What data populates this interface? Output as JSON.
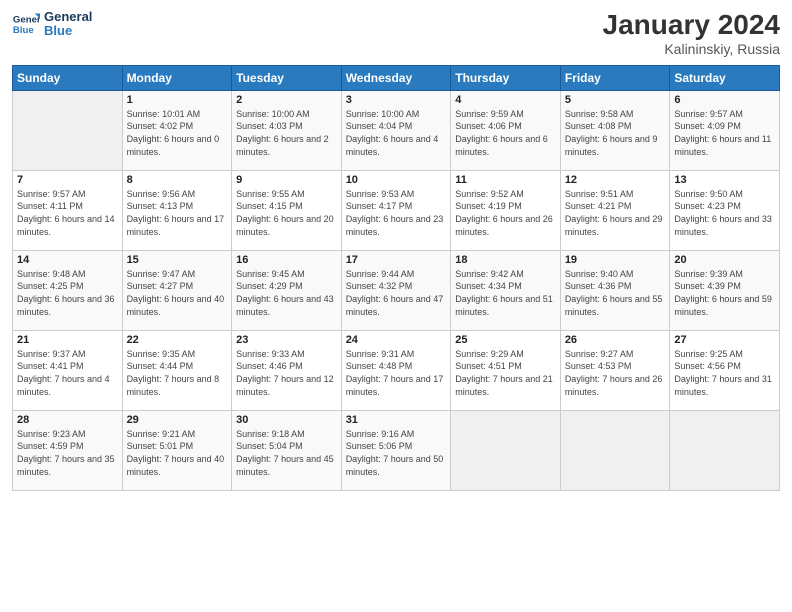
{
  "header": {
    "logo_line1": "General",
    "logo_line2": "Blue",
    "month": "January 2024",
    "location": "Kalininskiy, Russia"
  },
  "weekdays": [
    "Sunday",
    "Monday",
    "Tuesday",
    "Wednesday",
    "Thursday",
    "Friday",
    "Saturday"
  ],
  "weeks": [
    [
      {
        "day": "",
        "sunrise": "",
        "sunset": "",
        "daylight": ""
      },
      {
        "day": "1",
        "sunrise": "Sunrise: 10:01 AM",
        "sunset": "Sunset: 4:02 PM",
        "daylight": "Daylight: 6 hours and 0 minutes."
      },
      {
        "day": "2",
        "sunrise": "Sunrise: 10:00 AM",
        "sunset": "Sunset: 4:03 PM",
        "daylight": "Daylight: 6 hours and 2 minutes."
      },
      {
        "day": "3",
        "sunrise": "Sunrise: 10:00 AM",
        "sunset": "Sunset: 4:04 PM",
        "daylight": "Daylight: 6 hours and 4 minutes."
      },
      {
        "day": "4",
        "sunrise": "Sunrise: 9:59 AM",
        "sunset": "Sunset: 4:06 PM",
        "daylight": "Daylight: 6 hours and 6 minutes."
      },
      {
        "day": "5",
        "sunrise": "Sunrise: 9:58 AM",
        "sunset": "Sunset: 4:08 PM",
        "daylight": "Daylight: 6 hours and 9 minutes."
      },
      {
        "day": "6",
        "sunrise": "Sunrise: 9:57 AM",
        "sunset": "Sunset: 4:09 PM",
        "daylight": "Daylight: 6 hours and 11 minutes."
      }
    ],
    [
      {
        "day": "7",
        "sunrise": "Sunrise: 9:57 AM",
        "sunset": "Sunset: 4:11 PM",
        "daylight": "Daylight: 6 hours and 14 minutes."
      },
      {
        "day": "8",
        "sunrise": "Sunrise: 9:56 AM",
        "sunset": "Sunset: 4:13 PM",
        "daylight": "Daylight: 6 hours and 17 minutes."
      },
      {
        "day": "9",
        "sunrise": "Sunrise: 9:55 AM",
        "sunset": "Sunset: 4:15 PM",
        "daylight": "Daylight: 6 hours and 20 minutes."
      },
      {
        "day": "10",
        "sunrise": "Sunrise: 9:53 AM",
        "sunset": "Sunset: 4:17 PM",
        "daylight": "Daylight: 6 hours and 23 minutes."
      },
      {
        "day": "11",
        "sunrise": "Sunrise: 9:52 AM",
        "sunset": "Sunset: 4:19 PM",
        "daylight": "Daylight: 6 hours and 26 minutes."
      },
      {
        "day": "12",
        "sunrise": "Sunrise: 9:51 AM",
        "sunset": "Sunset: 4:21 PM",
        "daylight": "Daylight: 6 hours and 29 minutes."
      },
      {
        "day": "13",
        "sunrise": "Sunrise: 9:50 AM",
        "sunset": "Sunset: 4:23 PM",
        "daylight": "Daylight: 6 hours and 33 minutes."
      }
    ],
    [
      {
        "day": "14",
        "sunrise": "Sunrise: 9:48 AM",
        "sunset": "Sunset: 4:25 PM",
        "daylight": "Daylight: 6 hours and 36 minutes."
      },
      {
        "day": "15",
        "sunrise": "Sunrise: 9:47 AM",
        "sunset": "Sunset: 4:27 PM",
        "daylight": "Daylight: 6 hours and 40 minutes."
      },
      {
        "day": "16",
        "sunrise": "Sunrise: 9:45 AM",
        "sunset": "Sunset: 4:29 PM",
        "daylight": "Daylight: 6 hours and 43 minutes."
      },
      {
        "day": "17",
        "sunrise": "Sunrise: 9:44 AM",
        "sunset": "Sunset: 4:32 PM",
        "daylight": "Daylight: 6 hours and 47 minutes."
      },
      {
        "day": "18",
        "sunrise": "Sunrise: 9:42 AM",
        "sunset": "Sunset: 4:34 PM",
        "daylight": "Daylight: 6 hours and 51 minutes."
      },
      {
        "day": "19",
        "sunrise": "Sunrise: 9:40 AM",
        "sunset": "Sunset: 4:36 PM",
        "daylight": "Daylight: 6 hours and 55 minutes."
      },
      {
        "day": "20",
        "sunrise": "Sunrise: 9:39 AM",
        "sunset": "Sunset: 4:39 PM",
        "daylight": "Daylight: 6 hours and 59 minutes."
      }
    ],
    [
      {
        "day": "21",
        "sunrise": "Sunrise: 9:37 AM",
        "sunset": "Sunset: 4:41 PM",
        "daylight": "Daylight: 7 hours and 4 minutes."
      },
      {
        "day": "22",
        "sunrise": "Sunrise: 9:35 AM",
        "sunset": "Sunset: 4:44 PM",
        "daylight": "Daylight: 7 hours and 8 minutes."
      },
      {
        "day": "23",
        "sunrise": "Sunrise: 9:33 AM",
        "sunset": "Sunset: 4:46 PM",
        "daylight": "Daylight: 7 hours and 12 minutes."
      },
      {
        "day": "24",
        "sunrise": "Sunrise: 9:31 AM",
        "sunset": "Sunset: 4:48 PM",
        "daylight": "Daylight: 7 hours and 17 minutes."
      },
      {
        "day": "25",
        "sunrise": "Sunrise: 9:29 AM",
        "sunset": "Sunset: 4:51 PM",
        "daylight": "Daylight: 7 hours and 21 minutes."
      },
      {
        "day": "26",
        "sunrise": "Sunrise: 9:27 AM",
        "sunset": "Sunset: 4:53 PM",
        "daylight": "Daylight: 7 hours and 26 minutes."
      },
      {
        "day": "27",
        "sunrise": "Sunrise: 9:25 AM",
        "sunset": "Sunset: 4:56 PM",
        "daylight": "Daylight: 7 hours and 31 minutes."
      }
    ],
    [
      {
        "day": "28",
        "sunrise": "Sunrise: 9:23 AM",
        "sunset": "Sunset: 4:59 PM",
        "daylight": "Daylight: 7 hours and 35 minutes."
      },
      {
        "day": "29",
        "sunrise": "Sunrise: 9:21 AM",
        "sunset": "Sunset: 5:01 PM",
        "daylight": "Daylight: 7 hours and 40 minutes."
      },
      {
        "day": "30",
        "sunrise": "Sunrise: 9:18 AM",
        "sunset": "Sunset: 5:04 PM",
        "daylight": "Daylight: 7 hours and 45 minutes."
      },
      {
        "day": "31",
        "sunrise": "Sunrise: 9:16 AM",
        "sunset": "Sunset: 5:06 PM",
        "daylight": "Daylight: 7 hours and 50 minutes."
      },
      {
        "day": "",
        "sunrise": "",
        "sunset": "",
        "daylight": ""
      },
      {
        "day": "",
        "sunrise": "",
        "sunset": "",
        "daylight": ""
      },
      {
        "day": "",
        "sunrise": "",
        "sunset": "",
        "daylight": ""
      }
    ]
  ]
}
